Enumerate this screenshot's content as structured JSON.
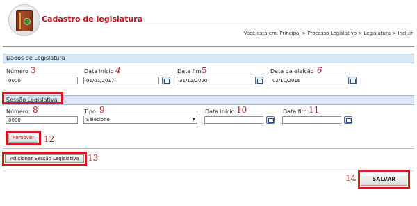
{
  "header": {
    "title": "Cadastro de legislatura",
    "breadcrumb": "Você está em: Principal > Processo Legislativo > Legislatura > Incluir"
  },
  "section1": {
    "title": "Dados de Legislatura",
    "fields": [
      {
        "label": "Número",
        "value": "0000",
        "callout": "3"
      },
      {
        "label": "Data início",
        "value": "01/01/2017",
        "callout": "4"
      },
      {
        "label": "Data fim",
        "value": "31/12/2020",
        "callout": "5"
      },
      {
        "label": "Data da eleição",
        "value": "02/10/2016",
        "callout": "6"
      }
    ]
  },
  "section2": {
    "title": "Sessão Legislativa",
    "fields": [
      {
        "label": "Número:",
        "value": "0000",
        "callout": "8"
      },
      {
        "label": "Tipo:",
        "value": "Selecione",
        "callout": "9"
      },
      {
        "label": "Data início:",
        "value": "",
        "callout": "10"
      },
      {
        "label": "Data fim:",
        "value": "",
        "callout": "11"
      }
    ],
    "remove_label": "Remover",
    "remove_callout": "12"
  },
  "add_session": {
    "label": "Adicionar Sessão Legislativa",
    "callout": "13"
  },
  "save": {
    "label": "SALVAR",
    "callout": "14"
  },
  "colors": {
    "accent_red": "#d41a1f",
    "section_bar": "#d8e6f6"
  }
}
